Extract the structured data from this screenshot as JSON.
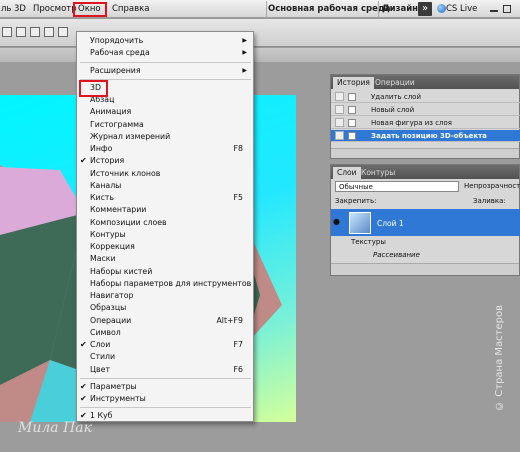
{
  "menubar": {
    "items": [
      "ль",
      "3D",
      "Просмотр",
      "Окно",
      "Справка"
    ],
    "workspace_main": "Основная рабочая среда",
    "workspace_design": "Дизайн",
    "cs_live": "CS Live"
  },
  "window_menu": {
    "items": [
      {
        "label": "Упорядочить",
        "submenu": true
      },
      {
        "label": "Рабочая среда",
        "submenu": true
      },
      {
        "label": "Расширения",
        "submenu": true
      },
      {
        "label": "3D"
      },
      {
        "label": "Абзац"
      },
      {
        "label": "Анимация"
      },
      {
        "label": "Гистограмма"
      },
      {
        "label": "Журнал измерений"
      },
      {
        "label": "Инфо",
        "shortcut": "F8"
      },
      {
        "label": "История",
        "checked": true
      },
      {
        "label": "Источник клонов"
      },
      {
        "label": "Каналы"
      },
      {
        "label": "Кисть",
        "shortcut": "F5"
      },
      {
        "label": "Комментарии"
      },
      {
        "label": "Композиции слоев"
      },
      {
        "label": "Контуры"
      },
      {
        "label": "Коррекция"
      },
      {
        "label": "Маски"
      },
      {
        "label": "Наборы кистей"
      },
      {
        "label": "Наборы параметров для инструментов"
      },
      {
        "label": "Навигатор"
      },
      {
        "label": "Образцы"
      },
      {
        "label": "Операции",
        "shortcut": "Alt+F9"
      },
      {
        "label": "Символ"
      },
      {
        "label": "Слои",
        "shortcut": "F7",
        "checked": true
      },
      {
        "label": "Стили"
      },
      {
        "label": "Цвет",
        "shortcut": "F6"
      },
      {
        "label": "Параметры",
        "checked": true
      },
      {
        "label": "Инструменты",
        "checked": true
      },
      {
        "label": "1 Куб",
        "checked": true
      }
    ]
  },
  "history_panel": {
    "tabs": [
      "История",
      "Операции"
    ],
    "rows": [
      "Удалить слой",
      "Новый слой",
      "Новая фигура из слоя",
      "Задать позицию 3D-объекта"
    ]
  },
  "layers_panel": {
    "tabs": [
      "Слои",
      "Контуры"
    ],
    "blend_mode": "Обычные",
    "opacity_label": "Непрозрачность:",
    "lock_label": "Закрепить:",
    "fill_label": "Заливка:",
    "layer_name": "Слой 1",
    "textures": "Текстуры",
    "scattering": "Рассеивание"
  },
  "watermark": {
    "author": "Мила Пак",
    "site": "© Страна Мастеров"
  },
  "colors": {
    "highlight_red": "#e0141e",
    "selection_blue": "#2f78d6"
  }
}
